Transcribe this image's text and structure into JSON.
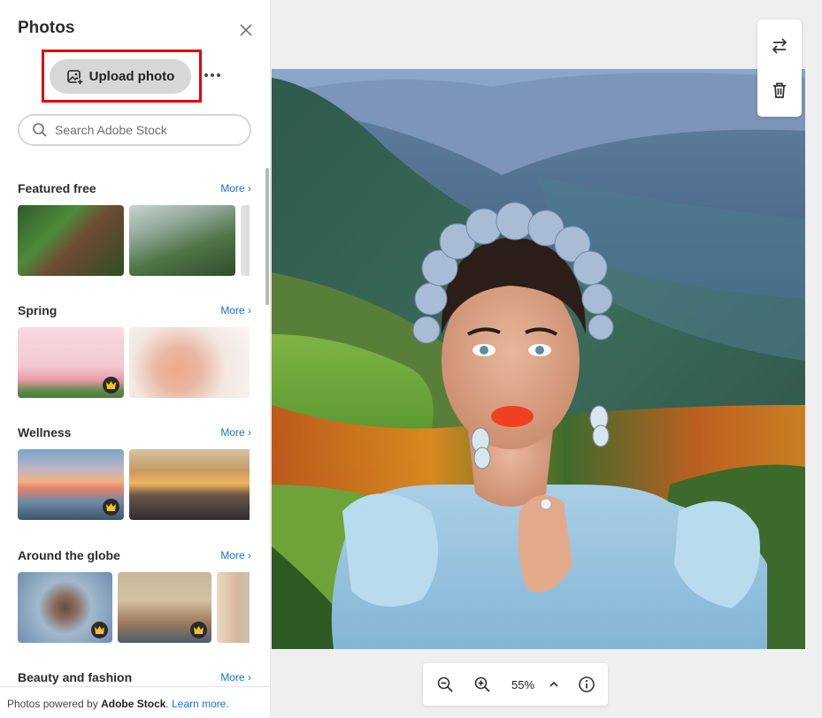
{
  "panel": {
    "title": "Photos",
    "upload_label": "Upload photo",
    "search_placeholder": "Search Adobe Stock",
    "sections": [
      {
        "title": "Featured free",
        "more": "More"
      },
      {
        "title": "Spring",
        "more": "More"
      },
      {
        "title": "Wellness",
        "more": "More"
      },
      {
        "title": "Around the globe",
        "more": "More"
      },
      {
        "title": "Beauty and fashion",
        "more": "More"
      }
    ],
    "footer": {
      "prefix": "Photos powered by ",
      "brand": "Adobe Stock",
      "suffix": ".",
      "link": "Learn more."
    }
  },
  "zoom": {
    "level": "55%"
  },
  "icons": {
    "close": "close-icon",
    "upload": "image-add-icon",
    "more": "more-horizontal-icon",
    "search": "search-icon",
    "chevron": "chevron-right-icon",
    "premium": "crown-icon",
    "swap": "swap-icon",
    "delete": "trash-icon",
    "zoom_out": "zoom-out-icon",
    "zoom_in": "zoom-in-icon",
    "expand": "chevron-up-icon",
    "info": "info-icon"
  },
  "colors": {
    "highlight": "#e0000c",
    "link": "#1473e6",
    "upload_button": "#d7d7d7"
  }
}
